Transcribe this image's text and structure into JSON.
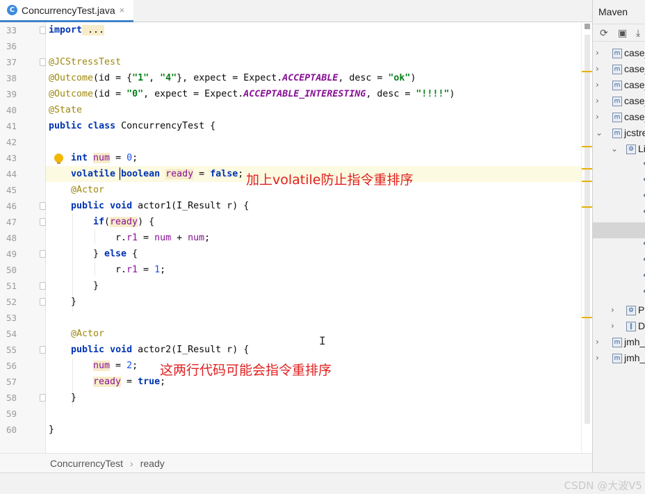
{
  "editor_tab": {
    "title": "ConcurrencyTest.java",
    "close": "×",
    "icon": "C"
  },
  "line_numbers": [
    "33",
    "36",
    "37",
    "38",
    "39",
    "40",
    "41",
    "42",
    "43",
    "44",
    "45",
    "46",
    "47",
    "48",
    "49",
    "50",
    "51",
    "52",
    "53",
    "54",
    "55",
    "56",
    "57",
    "58",
    "59",
    "60"
  ],
  "code": {
    "l33": {
      "kw": "import",
      "rest": " ..."
    },
    "l37": {
      "ann": "@JCStressTest"
    },
    "l38": {
      "a": "@Outcome",
      "b": "(id = {",
      "s1": "\"1\"",
      "c": ", ",
      "s2": "\"4\"",
      "d": "}, expect = Expect.",
      "e": "ACCEPTABLE",
      "f": ", desc = ",
      "s3": "\"ok\"",
      "g": ")"
    },
    "l39": {
      "a": "@Outcome",
      "b": "(id = ",
      "s1": "\"0\"",
      "c": ", expect = Expect.",
      "e": "ACCEPTABLE_INTERESTING",
      "f": ", desc = ",
      "s3": "\"!!!!\"",
      "g": ")"
    },
    "l40": {
      "ann": "@State"
    },
    "l41": {
      "kw1": "public",
      "kw2": "class",
      "rest": " ConcurrencyTest {"
    },
    "l43": {
      "kw": "int",
      "fld": "num",
      "eq": " = ",
      "num": "0",
      "end": ";"
    },
    "l44": {
      "kw1": "volatile",
      "kw2": "boolean",
      "fld": "ready",
      "eq": " = ",
      "kw3": "false",
      "end": ";"
    },
    "l45": {
      "ann": "@Actor"
    },
    "l46": {
      "kw1": "public",
      "kw2": "void",
      "rest": " actor1(I_Result r) {"
    },
    "l47": {
      "kw": "if",
      "a": "(",
      "fld": "ready",
      "b": ") {"
    },
    "l48": {
      "a": "r.",
      "f1": "r1",
      "b": " = ",
      "f2": "num",
      "c": " + ",
      "f3": "num",
      "d": ";"
    },
    "l49": {
      "a": "} ",
      "kw": "else",
      "b": " {"
    },
    "l50": {
      "a": "r.",
      "f1": "r1",
      "b": " = ",
      "num": "1",
      "d": ";"
    },
    "l51": {
      "a": "}"
    },
    "l52": {
      "a": "}"
    },
    "l54": {
      "ann": "@Actor"
    },
    "l55": {
      "kw1": "public",
      "kw2": "void",
      "rest": " actor2(I_Result r) {"
    },
    "l56": {
      "fld": "num",
      "eq": " = ",
      "num": "2",
      "end": ";"
    },
    "l57": {
      "fld": "ready",
      "eq": " = ",
      "kw": "true",
      "end": ";"
    },
    "l58": {
      "a": "}"
    },
    "l60": {
      "a": "}"
    }
  },
  "annotations": {
    "note1": "加上volatile防止指令重排序",
    "note2": "这两行代码可能会指令重排序"
  },
  "text_cursor": "I",
  "breadcrumb": {
    "class": "ConcurrencyTest",
    "sep": "›",
    "field": "ready"
  },
  "maven": {
    "title": "Maven",
    "toolbar": [
      "⟳",
      "▣",
      "⤓"
    ],
    "tree": [
      {
        "label": "case_",
        "arrow": "›"
      },
      {
        "label": "case_",
        "arrow": "›"
      },
      {
        "label": "case_",
        "arrow": "›"
      },
      {
        "label": "case_",
        "arrow": "›"
      },
      {
        "label": "case_",
        "arrow": "›"
      },
      {
        "label": "jcstre",
        "arrow": "⌄"
      },
      {
        "label": "Li",
        "arrow": "⌄"
      },
      {
        "label": "P",
        "arrow": "›"
      },
      {
        "label": "D",
        "arrow": "›"
      },
      {
        "label": "jmh_",
        "arrow": "›"
      },
      {
        "label": "jmh_",
        "arrow": "›"
      }
    ]
  },
  "watermark": "CSDN @大波V5",
  "colors": {
    "accent": "#4083c9",
    "note": "#e02020",
    "keyword": "#0033b3",
    "annotation": "#9e880d",
    "string": "#067d17",
    "number": "#1750eb",
    "field": "#871094"
  }
}
